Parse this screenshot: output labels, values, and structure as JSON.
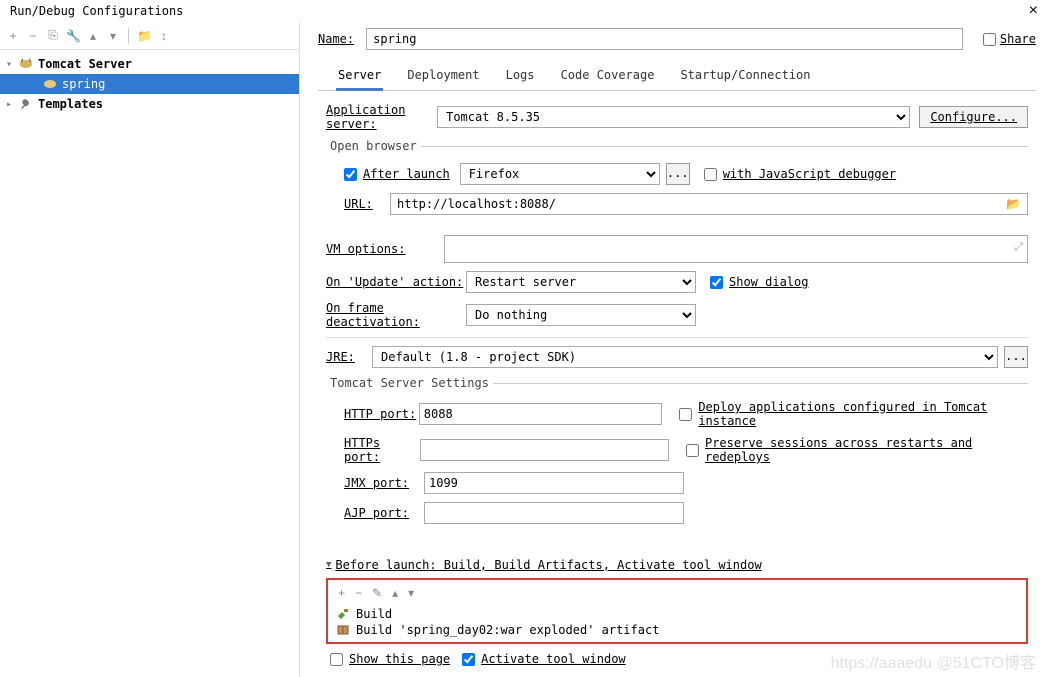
{
  "window": {
    "title": "Run/Debug Configurations",
    "close": "×"
  },
  "toolbar": {
    "add": "+",
    "remove": "−",
    "copy": "⎘",
    "wrench": "🔧",
    "up": "▴",
    "down": "▾",
    "folder": "📁",
    "sort": "↕"
  },
  "tree": {
    "tomcat_label": "Tomcat Server",
    "spring_label": "spring",
    "templates_label": "Templates"
  },
  "form": {
    "name_label": "Name:",
    "name_value": "spring",
    "share_label": "Share"
  },
  "tabs": {
    "server": "Server",
    "deployment": "Deployment",
    "logs": "Logs",
    "code_coverage": "Code Coverage",
    "startup": "Startup/Connection"
  },
  "server": {
    "app_server_label": "Application server:",
    "app_server_value": "Tomcat 8.5.35",
    "configure_btn": "Configure...",
    "open_browser_legend": "Open browser",
    "after_launch": "After launch",
    "browser_value": "Firefox",
    "dots": "...",
    "with_js_debugger": "with JavaScript debugger",
    "url_label": "URL:",
    "url_value": "http://localhost:8088/",
    "vm_options_label": "VM options:",
    "on_update_label": "On 'Update' action:",
    "on_update_value": "Restart server",
    "show_dialog": "Show dialog",
    "on_frame_label": "On frame deactivation:",
    "on_frame_value": "Do nothing",
    "jre_label": "JRE:",
    "jre_value": "Default (1.8 - project SDK)",
    "tomcat_settings_legend": "Tomcat Server Settings",
    "http_port_label": "HTTP port:",
    "http_port_value": "8088",
    "https_port_label": "HTTPs port:",
    "https_port_value": "",
    "jmx_port_label": "JMX port:",
    "jmx_port_value": "1099",
    "ajp_port_label": "AJP port:",
    "ajp_port_value": "",
    "deploy_apps": "Deploy applications configured in Tomcat instance",
    "preserve_sessions": "Preserve sessions across restarts and redeploys"
  },
  "before_launch": {
    "header": "Before launch: Build, Build Artifacts, Activate tool window",
    "tb_add": "+",
    "tb_remove": "−",
    "tb_edit": "✎",
    "tb_up": "▴",
    "tb_down": "▾",
    "item1": "Build",
    "item2": "Build 'spring_day02:war exploded' artifact",
    "show_page": "Show this page",
    "activate_window": "Activate tool window"
  },
  "watermark": "https://aaaedu @51CTO博客"
}
